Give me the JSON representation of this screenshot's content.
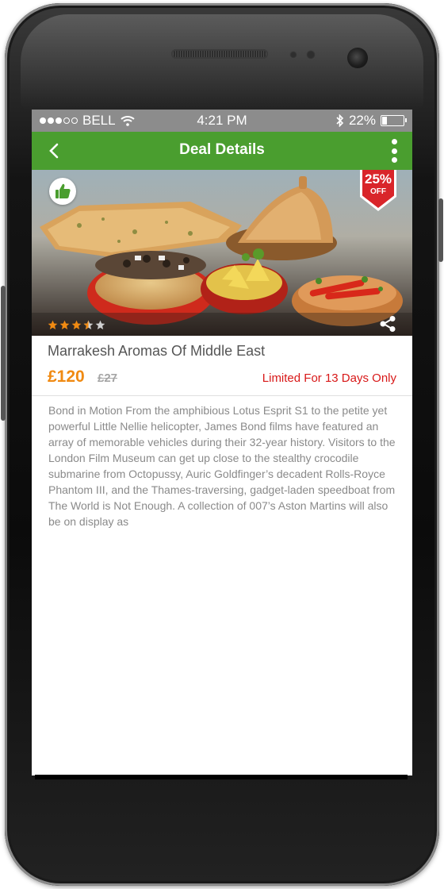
{
  "status_bar": {
    "carrier": "BELL",
    "time": "4:21 PM",
    "battery": "22%",
    "battery_level": 0.22,
    "signal_dots_filled": 3,
    "signal_dots_total": 5
  },
  "app_bar": {
    "title": "Deal Details",
    "color": "#4a9e2f"
  },
  "deal": {
    "discount_percent": "25%",
    "discount_label": "OFF",
    "rating": 3.5,
    "rating_max": 5,
    "title": "Marrakesh Aromas Of Middle East",
    "price": "£120",
    "old_price": "£27",
    "limited_text": "Limited For 13 Days Only",
    "description": "Bond in Motion From the amphibious Lotus Esprit S1 to the petite yet powerful Little Nellie helicopter, James Bond films have featured an array of memorable vehicles during their 32-year history. Visitors to the London Film Museum can get up close to the stealthy crocodile submarine from Octopussy, Auric Goldfinger’s decadent Rolls-Royce Phantom III, and the Thames-traversing, gadget-laden speedboat from The World is Not Enough. A collection of 007’s Aston Martins will also be on display as"
  },
  "colors": {
    "accent_green": "#4a9e2f",
    "price_orange": "#f08a12",
    "limited_red": "#d81818",
    "star_orange": "#f08a12",
    "discount_red": "#d9252a"
  },
  "icons": [
    "back-arrow-icon",
    "more-vert-icon",
    "thumbs-up-icon",
    "share-icon",
    "star-icon",
    "wifi-icon",
    "bluetooth-icon",
    "battery-icon"
  ]
}
